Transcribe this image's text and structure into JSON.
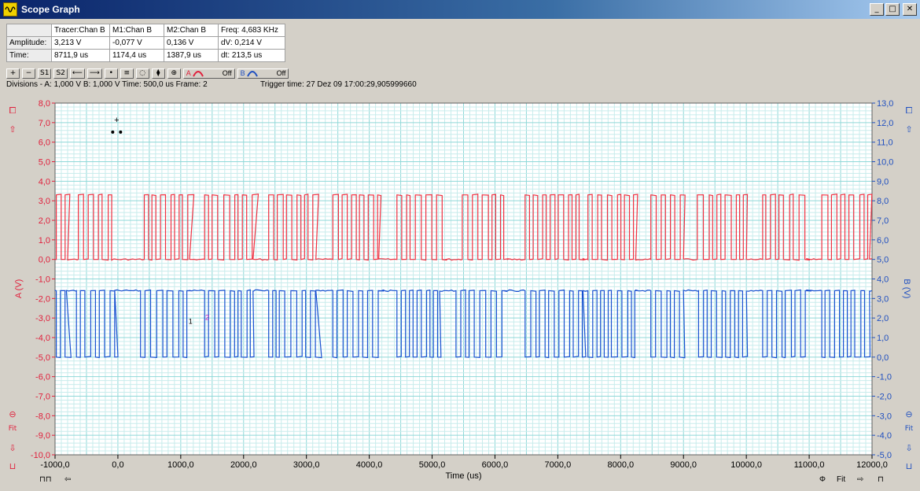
{
  "window": {
    "title": "Scope Graph",
    "minimize": "_",
    "maximize": "□",
    "close": "✕"
  },
  "measurements": {
    "headers": [
      "",
      "Tracer:Chan B",
      "M1:Chan B",
      "M2:Chan B",
      "Freq: 4,683 KHz"
    ],
    "rows": [
      [
        "Amplitude:",
        "3,213 V",
        "-0,077 V",
        "0,136 V",
        "dV: 0,214 V"
      ],
      [
        "Time:",
        "8711,9 us",
        "1174,4 us",
        "1387,9 us",
        "dt:  213,5 us"
      ]
    ]
  },
  "toolbar": {
    "buttons": [
      "+",
      "−",
      "S1",
      "S2",
      "⟵",
      "⟶",
      "•",
      "≡",
      "◌",
      "⧫",
      "⊕"
    ],
    "chanA": {
      "label": "A",
      "state": "Off"
    },
    "chanB": {
      "label": "B",
      "state": "Off"
    }
  },
  "info": {
    "divisions": "Divisions -  A: 1,000 V   B: 1,000 V   Time: 500,0 us  Frame: 2",
    "trigger": "Trigger time: 27 Dez 09 17:00:29,905999660"
  },
  "side_buttons": {
    "left_top": [
      "⧠",
      "⇧"
    ],
    "left_bottom": [
      "⊖",
      "Fit",
      "⇩",
      "⊔"
    ],
    "right_top": [
      "⧠",
      "⇧"
    ],
    "right_bottom": [
      "⊖",
      "Fit",
      "⇩",
      "⊔"
    ]
  },
  "bottom_buttons": {
    "left": [
      "⊓⊓",
      "⇦"
    ],
    "right": [
      "Φ",
      "Fit",
      "⇨",
      "⊓"
    ]
  },
  "colors": {
    "red": "#f03040",
    "blue": "#1850d0",
    "grid": "#8fd8d8",
    "gridMinor": "#c8ecec",
    "plotBg": "#ffffff"
  },
  "markers": {
    "m1": "1",
    "m2": "2",
    "cursor": "+"
  },
  "chart_data": {
    "type": "line",
    "xlabel": "Time (us)",
    "ylabel_left": "A (V)",
    "ylabel_right": "B (V)",
    "xlim": [
      -1000,
      12000
    ],
    "ylim_left": [
      -10,
      8
    ],
    "ylim_right": [
      -5,
      13
    ],
    "x_ticks": [
      "-1000,0",
      "0,0",
      "1000,0",
      "2000,0",
      "3000,0",
      "4000,0",
      "5000,0",
      "6000,0",
      "7000,0",
      "8000,0",
      "9000,0",
      "10000,0",
      "11000,0",
      "12000,0"
    ],
    "y_left_ticks": [
      "8,0",
      "7,0",
      "6,0",
      "5,0",
      "4,0",
      "3,0",
      "2,0",
      "1,0",
      "0,0",
      "-1,0",
      "-2,0",
      "-3,0",
      "-4,0",
      "-5,0",
      "-6,0",
      "-7,0",
      "-8,0",
      "-9,0",
      "-10,0"
    ],
    "y_right_ticks": [
      "13,0",
      "12,0",
      "11,0",
      "10,0",
      "9,0",
      "8,0",
      "7,0",
      "6,0",
      "5,0",
      "4,0",
      "3,0",
      "2,0",
      "1,0",
      "0,0",
      "-1,0",
      "-2,0",
      "-3,0",
      "-4,0",
      "-5,0"
    ],
    "grid": true,
    "series": [
      {
        "axis": "left",
        "color": "#f03040",
        "low": 0.0,
        "high": 3.3,
        "bursts": [
          [
            -980,
            -800
          ],
          [
            -630,
            -100
          ],
          [
            420,
            1140
          ],
          [
            1380,
            2150
          ],
          [
            2400,
            3150
          ],
          [
            3420,
            4150
          ],
          [
            4440,
            5160
          ],
          [
            5480,
            6200
          ],
          [
            6480,
            7400
          ],
          [
            7480,
            8240
          ],
          [
            8480,
            9000
          ],
          [
            9220,
            10000
          ],
          [
            10260,
            10960
          ],
          [
            11200,
            11960
          ]
        ]
      },
      {
        "axis": "right",
        "color": "#1850d0",
        "low": 0.0,
        "high": 3.4,
        "bursts": [
          [
            -980,
            -820
          ],
          [
            -660,
            -50
          ],
          [
            360,
            1140
          ],
          [
            1380,
            2150
          ],
          [
            2400,
            3150
          ],
          [
            3420,
            4150
          ],
          [
            4440,
            5120
          ],
          [
            5380,
            6150
          ],
          [
            6480,
            7400
          ],
          [
            7480,
            8240
          ],
          [
            8480,
            9000
          ],
          [
            9240,
            10000
          ],
          [
            10260,
            10960
          ],
          [
            11200,
            11960
          ]
        ]
      }
    ],
    "cursor_marker": {
      "x": -20,
      "y_left": 7.0
    }
  }
}
